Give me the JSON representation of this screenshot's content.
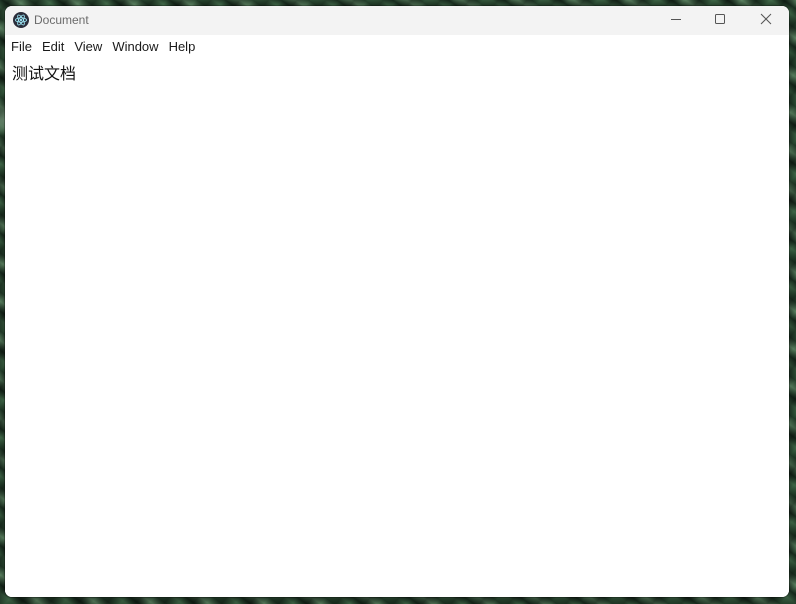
{
  "window": {
    "title": "Document",
    "app_icon": "electron-icon",
    "controls": {
      "minimize_icon": "minimize-icon",
      "maximize_icon": "maximize-icon",
      "close_icon": "close-icon"
    }
  },
  "menubar": {
    "items": [
      {
        "label": "File"
      },
      {
        "label": "Edit"
      },
      {
        "label": "View"
      },
      {
        "label": "Window"
      },
      {
        "label": "Help"
      }
    ]
  },
  "content": {
    "text": "测试文档"
  },
  "colors": {
    "titlebar_bg": "#f3f3f3",
    "window_bg": "#ffffff",
    "title_text": "#6b6b6b",
    "menu_text": "#1a1a1a"
  }
}
